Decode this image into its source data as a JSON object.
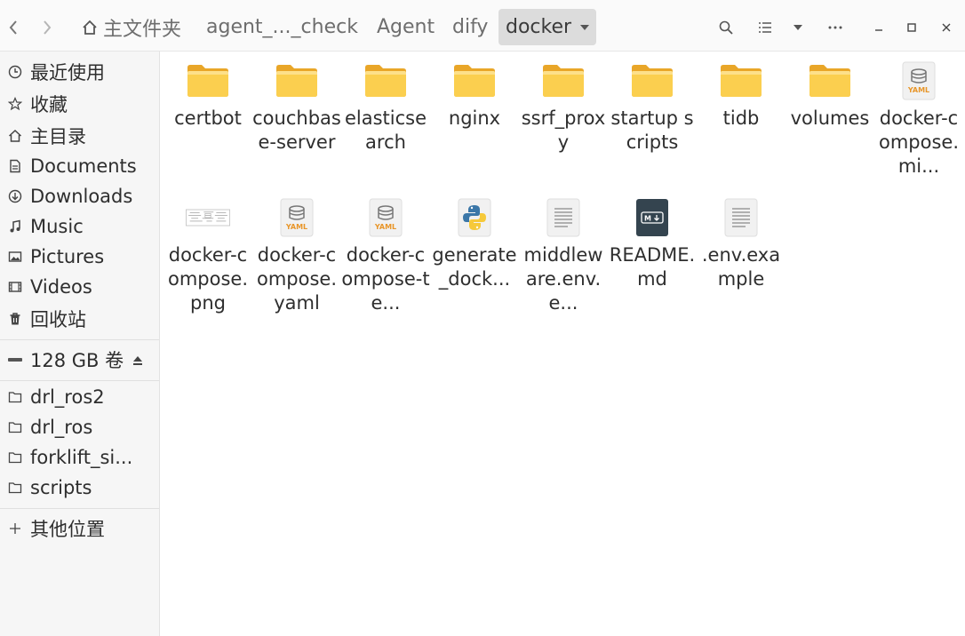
{
  "breadcrumb": {
    "home_label": "主文件夹",
    "items": [
      "agent_..._check",
      "Agent",
      "dify",
      "docker"
    ]
  },
  "header": {
    "back_icon": "chevron-left-icon",
    "forward_icon": "chevron-right-icon",
    "search_icon": "search-icon",
    "view_icon": "list-view-icon",
    "sort_icon": "chevron-down-icon",
    "menu_icon": "more-icon"
  },
  "sidebar": {
    "items": [
      {
        "label": "最近使用",
        "icon": "clock-icon"
      },
      {
        "label": "收藏",
        "icon": "star-icon"
      },
      {
        "label": "主目录",
        "icon": "home-icon"
      },
      {
        "label": "Documents",
        "icon": "document-icon"
      },
      {
        "label": "Downloads",
        "icon": "download-icon"
      },
      {
        "label": "Music",
        "icon": "music-icon"
      },
      {
        "label": "Pictures",
        "icon": "picture-icon"
      },
      {
        "label": "Videos",
        "icon": "video-icon"
      },
      {
        "label": "回收站",
        "icon": "trash-icon"
      }
    ],
    "volume": {
      "label": "128 GB 卷",
      "icon": "drive-icon"
    },
    "bookmarks": [
      {
        "label": "drl_ros2"
      },
      {
        "label": "drl_ros"
      },
      {
        "label": "forklift_si..."
      },
      {
        "label": "scripts"
      }
    ],
    "other": {
      "label": "其他位置",
      "icon": "plus-icon"
    }
  },
  "files": [
    {
      "name": "certbot",
      "type": "folder"
    },
    {
      "name": "couchbase-server",
      "type": "folder"
    },
    {
      "name": "elasticsearch",
      "type": "folder"
    },
    {
      "name": "nginx",
      "type": "folder"
    },
    {
      "name": "ssrf_proxy",
      "type": "folder"
    },
    {
      "name": "startup scripts",
      "type": "folder"
    },
    {
      "name": "tidb",
      "type": "folder"
    },
    {
      "name": "volumes",
      "type": "folder"
    },
    {
      "name": "docker-compose.mi...",
      "type": "yaml"
    },
    {
      "name": "docker-compose.png",
      "type": "image"
    },
    {
      "name": "docker-compose.yaml",
      "type": "yaml"
    },
    {
      "name": "docker-compose-te...",
      "type": "yaml"
    },
    {
      "name": "generate_dock...",
      "type": "python"
    },
    {
      "name": "middleware.env.e...",
      "type": "text"
    },
    {
      "name": "README.md",
      "type": "markdown"
    },
    {
      "name": ".env.example",
      "type": "text"
    }
  ],
  "colors": {
    "folder": "#f8c440",
    "folder_light": "#fbd86a",
    "accent": "#dcdcdc"
  }
}
